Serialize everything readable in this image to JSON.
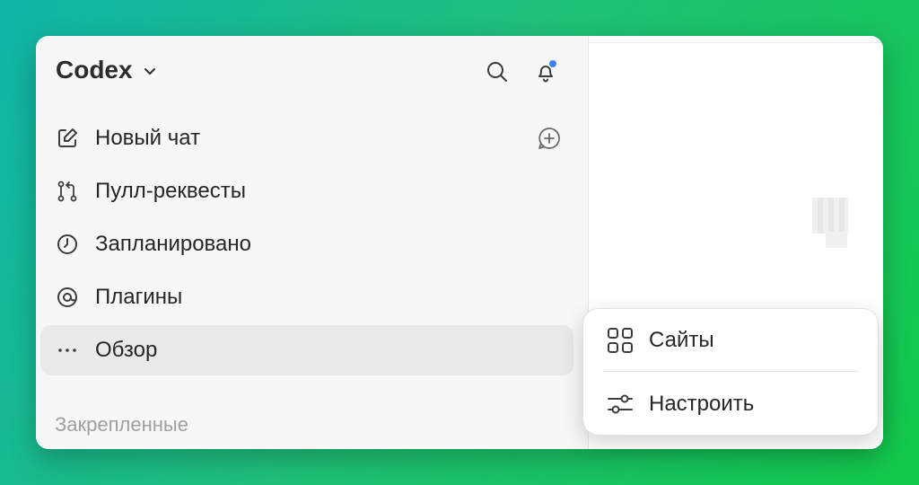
{
  "app": {
    "title": "Codex"
  },
  "header": {
    "search_icon": "search-icon",
    "bell_icon": "bell-icon",
    "notification_color": "#3b82f6"
  },
  "sidebar": {
    "items": [
      {
        "label": "Новый чат",
        "icon": "edit-icon"
      },
      {
        "label": "Пулл-реквесты",
        "icon": "pull-request-icon"
      },
      {
        "label": "Запланировано",
        "icon": "clock-icon"
      },
      {
        "label": "Плагины",
        "icon": "plugin-icon"
      },
      {
        "label": "Обзор",
        "icon": "more-icon",
        "active": true
      }
    ],
    "pinned_title": "Закрепленные"
  },
  "popover": {
    "items": [
      {
        "label": "Сайты",
        "icon": "apps-grid-icon"
      },
      {
        "label": "Настроить",
        "icon": "sliders-icon"
      }
    ]
  },
  "main_edge": {
    "t1": "le",
    "t2": "o",
    "t3": "но"
  },
  "colors": {
    "accent": "#3b82f6",
    "active_bg": "#e9e9e9",
    "muted": "#a0a0a0"
  }
}
